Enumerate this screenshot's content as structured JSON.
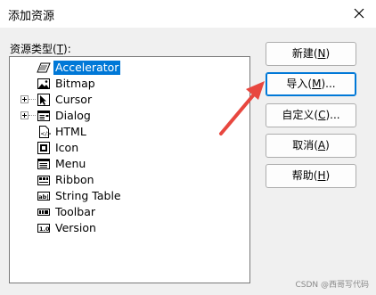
{
  "dialog": {
    "title": "添加资源"
  },
  "resource_types": {
    "label_text": "资源类型(",
    "label_accel": "T",
    "label_end": "):"
  },
  "tree": [
    {
      "label": "Accelerator",
      "icon": "accelerator-icon",
      "expandable": false,
      "selected": true
    },
    {
      "label": "Bitmap",
      "icon": "bitmap-icon",
      "expandable": false,
      "selected": false
    },
    {
      "label": "Cursor",
      "icon": "cursor-icon",
      "expandable": true,
      "selected": false
    },
    {
      "label": "Dialog",
      "icon": "dialog-icon",
      "expandable": true,
      "selected": false
    },
    {
      "label": "HTML",
      "icon": "html-icon",
      "expandable": false,
      "selected": false
    },
    {
      "label": "Icon",
      "icon": "icon-resource-icon",
      "expandable": false,
      "selected": false
    },
    {
      "label": "Menu",
      "icon": "menu-icon",
      "expandable": false,
      "selected": false
    },
    {
      "label": "Ribbon",
      "icon": "ribbon-icon",
      "expandable": false,
      "selected": false
    },
    {
      "label": "String Table",
      "icon": "string-table-icon",
      "expandable": false,
      "selected": false
    },
    {
      "label": "Toolbar",
      "icon": "toolbar-icon",
      "expandable": false,
      "selected": false
    },
    {
      "label": "Version",
      "icon": "version-icon",
      "expandable": false,
      "selected": false
    }
  ],
  "buttons": {
    "new": {
      "text": "新建(",
      "accel": "N",
      "end": ")"
    },
    "import": {
      "text": "导入(",
      "accel": "M",
      "end": ")..."
    },
    "custom": {
      "text": "自定义(",
      "accel": "C",
      "end": ")..."
    },
    "cancel": {
      "text": "取消(",
      "accel": "A",
      "end": ")"
    },
    "help": {
      "text": "帮助(",
      "accel": "H",
      "end": ")"
    }
  },
  "watermark": "CSDN @西哥写代码",
  "colors": {
    "selection": "#0078d7",
    "arrow": "#e8473f",
    "default_border": "#0078d7"
  }
}
